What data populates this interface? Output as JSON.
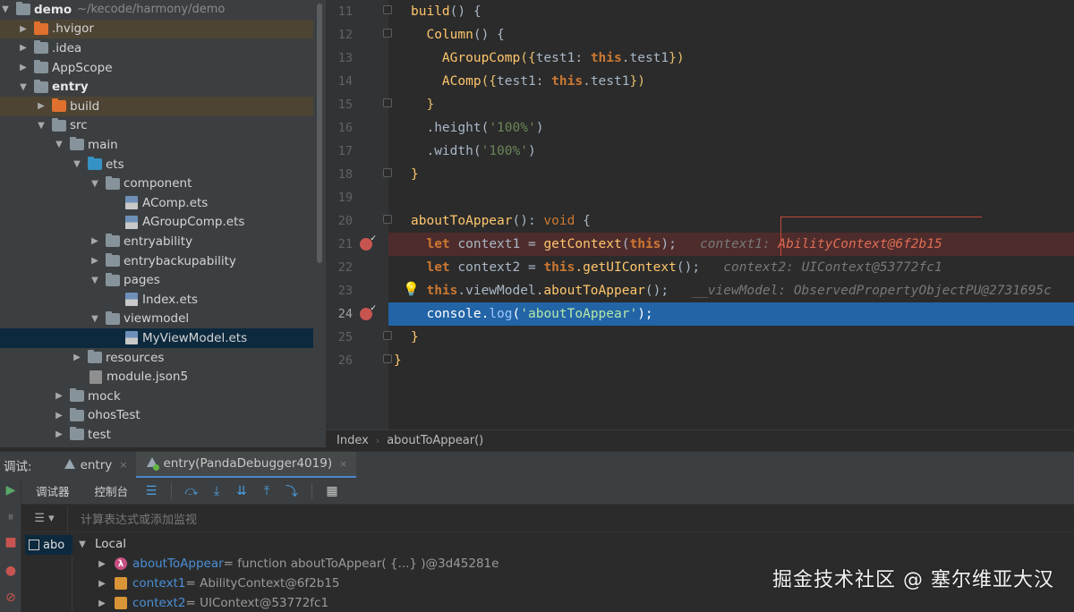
{
  "project_tree": {
    "root": {
      "name": "demo",
      "path": "~/kecode/harmony/demo"
    },
    "items": [
      {
        "label": ".hvigor",
        "icon": "folder-orange-icon",
        "chevron": "right"
      },
      {
        "label": ".idea",
        "icon": "folder-icon",
        "chevron": "right"
      },
      {
        "label": "AppScope",
        "icon": "folder-icon",
        "chevron": "right"
      },
      {
        "label": "entry",
        "icon": "folder-icon",
        "chevron": "down"
      },
      {
        "label": "build",
        "icon": "folder-orange-icon",
        "chevron": "right"
      },
      {
        "label": "src",
        "icon": "folder-icon",
        "chevron": "down"
      },
      {
        "label": "main",
        "icon": "folder-icon",
        "chevron": "down"
      },
      {
        "label": "ets",
        "icon": "folder-blue-icon",
        "chevron": "down"
      },
      {
        "label": "component",
        "icon": "folder-icon",
        "chevron": "down"
      },
      {
        "label": "AComp.ets",
        "icon": "ets-file-icon"
      },
      {
        "label": "AGroupComp.ets",
        "icon": "ets-file-icon"
      },
      {
        "label": "entryability",
        "icon": "folder-icon",
        "chevron": "right"
      },
      {
        "label": "entrybackupability",
        "icon": "folder-icon",
        "chevron": "right"
      },
      {
        "label": "pages",
        "icon": "folder-icon",
        "chevron": "down"
      },
      {
        "label": "Index.ets",
        "icon": "ets-file-icon"
      },
      {
        "label": "viewmodel",
        "icon": "folder-icon",
        "chevron": "down"
      },
      {
        "label": "MyViewModel.ets",
        "icon": "ets-file-icon"
      },
      {
        "label": "resources",
        "icon": "folder-icon",
        "chevron": "right"
      },
      {
        "label": "module.json5",
        "icon": "json-file-icon"
      },
      {
        "label": "mock",
        "icon": "folder-icon",
        "chevron": "right"
      },
      {
        "label": "ohosTest",
        "icon": "folder-icon",
        "chevron": "right"
      },
      {
        "label": "test",
        "icon": "folder-icon",
        "chevron": "right"
      }
    ]
  },
  "editor": {
    "line_numbers": [
      "11",
      "12",
      "13",
      "14",
      "15",
      "16",
      "17",
      "18",
      "19",
      "20",
      "21",
      "22",
      "23",
      "24",
      "25",
      "26"
    ],
    "current_line": "24",
    "code": {
      "l11_build": "build",
      "l11_rest": "() {",
      "l12_column": "Column",
      "l12_rest": "() {",
      "l13_fn": "AGroupComp",
      "l13_open": "({",
      "l13_key": "test1",
      "l13_colon": ": ",
      "l13_this": "this",
      "l13_prop": ".test1",
      "l13_close": "})",
      "l14_fn": "AComp",
      "l14_open": "({",
      "l14_key": "test1",
      "l14_colon": ": ",
      "l14_this": "this",
      "l14_prop": ".test1",
      "l14_close": "})",
      "l15": "}",
      "l16_dot": ".",
      "l16_fn": "height",
      "l16_str": "'100%'",
      "l17_dot": ".",
      "l17_fn": "width",
      "l17_str": "'100%'",
      "l18": "}",
      "l20_fn": "aboutToAppear",
      "l20_rest": "(): ",
      "l20_void": "void",
      "l20_brace": " {",
      "l21_let": "let",
      "l21_var": " context1 = ",
      "l21_fn": "getContext",
      "l21_this": "this",
      "l21_end": ");",
      "l21_hint_label": "context1: ",
      "l21_hint_value": "AbilityContext@6f2b15",
      "l22_let": "let",
      "l22_var": " context2 = ",
      "l22_this": "this",
      "l22_fn": ".getUIContext",
      "l22_end": "();",
      "l22_hint": "context2: UIContext@53772fc1",
      "l23_this": "this",
      "l23_mid": ".viewModel.",
      "l23_fn": "aboutToAppear",
      "l23_end": "();",
      "l23_hint": "__viewModel: ObservedPropertyObjectPU@2731695c",
      "l24_obj": "console",
      "l24_dot": ".",
      "l24_fn": "log",
      "l24_str": "'aboutToAppear'",
      "l24_end": ");",
      "l25": "}",
      "l26": "}"
    }
  },
  "breadcrumb": {
    "items": [
      "Index",
      "aboutToAppear()"
    ]
  },
  "debug": {
    "label": "调试:",
    "tabs": [
      {
        "label": "entry",
        "close": "×"
      },
      {
        "label": "entry(PandaDebugger4019)",
        "close": "×"
      }
    ],
    "toolbar": {
      "debugger_tab": "调试器",
      "console_tab": "控制台"
    },
    "watch_placeholder": "计算表达式或添加监视",
    "frame_label": "abo",
    "variables": {
      "group": "Local",
      "rows": [
        {
          "name": "aboutToAppear",
          "value": " = function aboutToAppear( {...} )@3d45281e",
          "icon": "lambda-icon"
        },
        {
          "name": "context1",
          "value": " = AbilityContext@6f2b15",
          "icon": "field-icon"
        },
        {
          "name": "context2",
          "value": " = UIContext@53772fc1",
          "icon": "field-icon"
        }
      ]
    }
  },
  "watermark": "掘金技术社区 @ 塞尔维亚大汉",
  "colors": {
    "editor_bg": "#2b2b2b",
    "panel_bg": "#3c3f41",
    "current_line": "#2264a6",
    "error_line": "#4e2c2c",
    "keyword": "#cc7832",
    "function": "#ffc66d",
    "string": "#6a8759",
    "link_blue": "#4a8fd6"
  }
}
